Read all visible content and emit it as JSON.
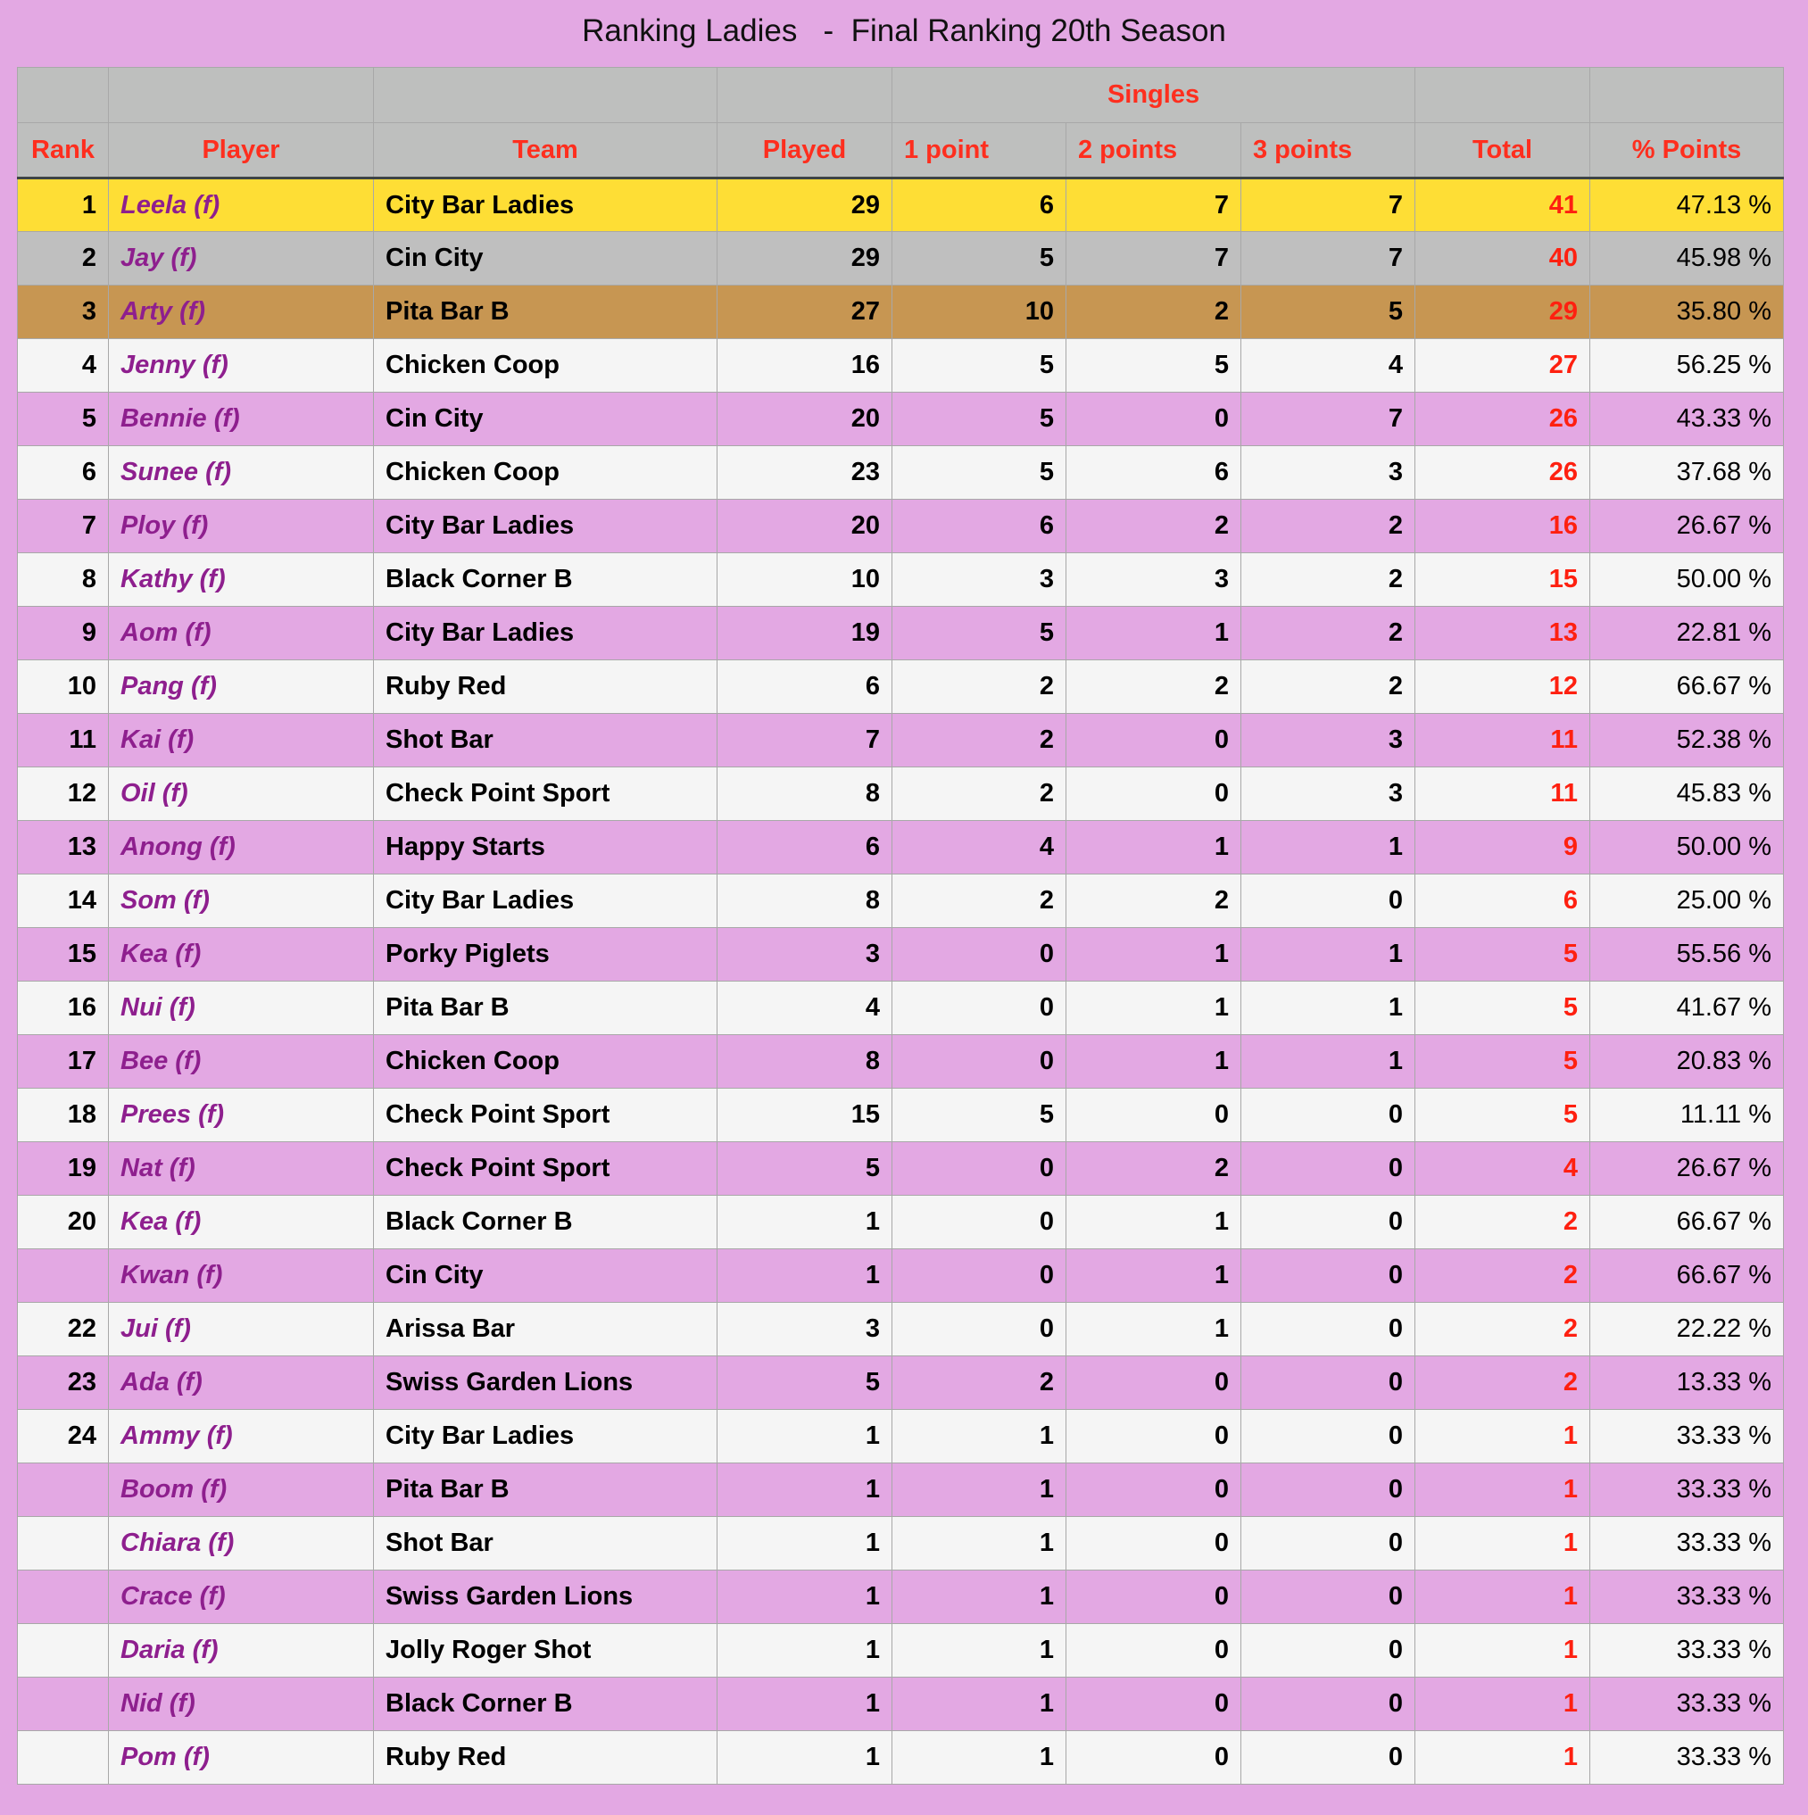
{
  "page": {
    "title": "Ranking Ladies   -  Final Ranking 20th Season"
  },
  "colors": {
    "background": "#e3a8e3",
    "header_bg": "#bebfbe",
    "header_text": "#fe2e1e",
    "gold": "#fede35",
    "silver": "#bfbfbf",
    "bronze": "#c79652",
    "row_light": "#f5f5f5",
    "row_pink": "#e3a8e3",
    "player_text": "#8e1f8e",
    "total_text": "#fe2010"
  },
  "table": {
    "group_header": "Singles",
    "columns": [
      "Rank",
      "Player",
      "Team",
      "Played",
      "1 point",
      "2 points",
      "3 points",
      "Total",
      "% Points"
    ],
    "rows": [
      {
        "rank": "1",
        "player": "Leela (f)",
        "team": "City Bar Ladies",
        "played": "29",
        "p1": "6",
        "p2": "7",
        "p3": "7",
        "total": "41",
        "pct": "47.13 %",
        "style": "gold"
      },
      {
        "rank": "2",
        "player": "Jay (f)",
        "team": "Cin City",
        "played": "29",
        "p1": "5",
        "p2": "7",
        "p3": "7",
        "total": "40",
        "pct": "45.98 %",
        "style": "silver"
      },
      {
        "rank": "3",
        "player": "Arty (f)",
        "team": "Pita Bar B",
        "played": "27",
        "p1": "10",
        "p2": "2",
        "p3": "5",
        "total": "29",
        "pct": "35.80 %",
        "style": "bronze"
      },
      {
        "rank": "4",
        "player": "Jenny (f)",
        "team": "Chicken Coop",
        "played": "16",
        "p1": "5",
        "p2": "5",
        "p3": "4",
        "total": "27",
        "pct": "56.25 %",
        "style": "light"
      },
      {
        "rank": "5",
        "player": "Bennie (f)",
        "team": "Cin City",
        "played": "20",
        "p1": "5",
        "p2": "0",
        "p3": "7",
        "total": "26",
        "pct": "43.33 %",
        "style": "pink"
      },
      {
        "rank": "6",
        "player": "Sunee (f)",
        "team": "Chicken Coop",
        "played": "23",
        "p1": "5",
        "p2": "6",
        "p3": "3",
        "total": "26",
        "pct": "37.68 %",
        "style": "light"
      },
      {
        "rank": "7",
        "player": "Ploy (f)",
        "team": "City Bar Ladies",
        "played": "20",
        "p1": "6",
        "p2": "2",
        "p3": "2",
        "total": "16",
        "pct": "26.67 %",
        "style": "pink"
      },
      {
        "rank": "8",
        "player": "Kathy (f)",
        "team": "Black Corner B",
        "played": "10",
        "p1": "3",
        "p2": "3",
        "p3": "2",
        "total": "15",
        "pct": "50.00 %",
        "style": "light"
      },
      {
        "rank": "9",
        "player": "Aom (f)",
        "team": "City Bar Ladies",
        "played": "19",
        "p1": "5",
        "p2": "1",
        "p3": "2",
        "total": "13",
        "pct": "22.81 %",
        "style": "pink"
      },
      {
        "rank": "10",
        "player": "Pang (f)",
        "team": "Ruby Red",
        "played": "6",
        "p1": "2",
        "p2": "2",
        "p3": "2",
        "total": "12",
        "pct": "66.67 %",
        "style": "light"
      },
      {
        "rank": "11",
        "player": "Kai (f)",
        "team": "Shot Bar",
        "played": "7",
        "p1": "2",
        "p2": "0",
        "p3": "3",
        "total": "11",
        "pct": "52.38 %",
        "style": "pink"
      },
      {
        "rank": "12",
        "player": "Oil (f)",
        "team": "Check Point Sport",
        "played": "8",
        "p1": "2",
        "p2": "0",
        "p3": "3",
        "total": "11",
        "pct": "45.83 %",
        "style": "light"
      },
      {
        "rank": "13",
        "player": "Anong (f)",
        "team": "Happy Starts",
        "played": "6",
        "p1": "4",
        "p2": "1",
        "p3": "1",
        "total": "9",
        "pct": "50.00 %",
        "style": "pink"
      },
      {
        "rank": "14",
        "player": "Som (f)",
        "team": "City Bar Ladies",
        "played": "8",
        "p1": "2",
        "p2": "2",
        "p3": "0",
        "total": "6",
        "pct": "25.00 %",
        "style": "light"
      },
      {
        "rank": "15",
        "player": "Kea (f)",
        "team": "Porky Piglets",
        "played": "3",
        "p1": "0",
        "p2": "1",
        "p3": "1",
        "total": "5",
        "pct": "55.56 %",
        "style": "pink"
      },
      {
        "rank": "16",
        "player": "Nui (f)",
        "team": "Pita Bar B",
        "played": "4",
        "p1": "0",
        "p2": "1",
        "p3": "1",
        "total": "5",
        "pct": "41.67 %",
        "style": "light"
      },
      {
        "rank": "17",
        "player": "Bee (f)",
        "team": "Chicken Coop",
        "played": "8",
        "p1": "0",
        "p2": "1",
        "p3": "1",
        "total": "5",
        "pct": "20.83 %",
        "style": "pink"
      },
      {
        "rank": "18",
        "player": "Prees (f)",
        "team": "Check Point Sport",
        "played": "15",
        "p1": "5",
        "p2": "0",
        "p3": "0",
        "total": "5",
        "pct": "11.11 %",
        "style": "light"
      },
      {
        "rank": "19",
        "player": "Nat (f)",
        "team": "Check Point Sport",
        "played": "5",
        "p1": "0",
        "p2": "2",
        "p3": "0",
        "total": "4",
        "pct": "26.67 %",
        "style": "pink"
      },
      {
        "rank": "20",
        "player": "Kea (f)",
        "team": "Black Corner B",
        "played": "1",
        "p1": "0",
        "p2": "1",
        "p3": "0",
        "total": "2",
        "pct": "66.67 %",
        "style": "light"
      },
      {
        "rank": "",
        "player": "Kwan (f)",
        "team": "Cin City",
        "played": "1",
        "p1": "0",
        "p2": "1",
        "p3": "0",
        "total": "2",
        "pct": "66.67 %",
        "style": "pink"
      },
      {
        "rank": "22",
        "player": "Jui (f)",
        "team": "Arissa Bar",
        "played": "3",
        "p1": "0",
        "p2": "1",
        "p3": "0",
        "total": "2",
        "pct": "22.22 %",
        "style": "light"
      },
      {
        "rank": "23",
        "player": "Ada (f)",
        "team": "Swiss Garden Lions",
        "played": "5",
        "p1": "2",
        "p2": "0",
        "p3": "0",
        "total": "2",
        "pct": "13.33 %",
        "style": "pink"
      },
      {
        "rank": "24",
        "player": "Ammy (f)",
        "team": "City Bar Ladies",
        "played": "1",
        "p1": "1",
        "p2": "0",
        "p3": "0",
        "total": "1",
        "pct": "33.33 %",
        "style": "light"
      },
      {
        "rank": "",
        "player": "Boom (f)",
        "team": "Pita Bar B",
        "played": "1",
        "p1": "1",
        "p2": "0",
        "p3": "0",
        "total": "1",
        "pct": "33.33 %",
        "style": "pink"
      },
      {
        "rank": "",
        "player": "Chiara (f)",
        "team": "Shot Bar",
        "played": "1",
        "p1": "1",
        "p2": "0",
        "p3": "0",
        "total": "1",
        "pct": "33.33 %",
        "style": "light"
      },
      {
        "rank": "",
        "player": "Crace (f)",
        "team": "Swiss Garden Lions",
        "played": "1",
        "p1": "1",
        "p2": "0",
        "p3": "0",
        "total": "1",
        "pct": "33.33 %",
        "style": "pink"
      },
      {
        "rank": "",
        "player": "Daria (f)",
        "team": "Jolly Roger Shot",
        "played": "1",
        "p1": "1",
        "p2": "0",
        "p3": "0",
        "total": "1",
        "pct": "33.33 %",
        "style": "light"
      },
      {
        "rank": "",
        "player": "Nid (f)",
        "team": "Black Corner B",
        "played": "1",
        "p1": "1",
        "p2": "0",
        "p3": "0",
        "total": "1",
        "pct": "33.33 %",
        "style": "pink"
      },
      {
        "rank": "",
        "player": "Pom (f)",
        "team": "Ruby Red",
        "played": "1",
        "p1": "1",
        "p2": "0",
        "p3": "0",
        "total": "1",
        "pct": "33.33 %",
        "style": "light"
      }
    ]
  }
}
